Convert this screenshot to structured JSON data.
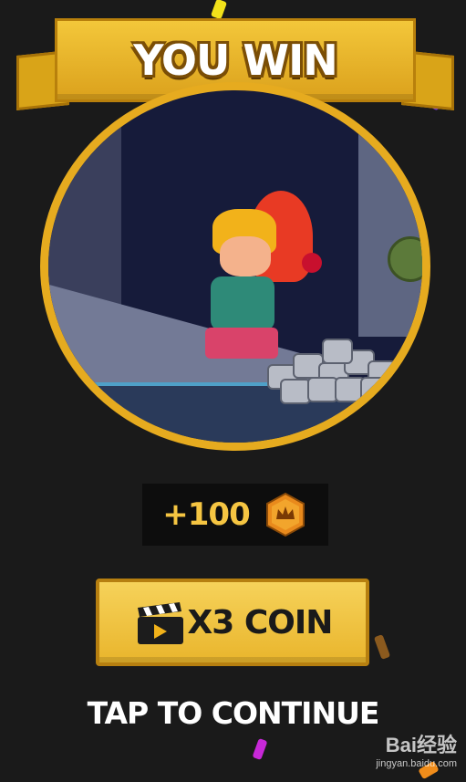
{
  "banner": {
    "title": "YOU WIN"
  },
  "reward": {
    "amount": "+100",
    "icon": "crown-coin-icon"
  },
  "video_bonus": {
    "label": "X3 COIN",
    "icon": "video-clapper-icon"
  },
  "tap_continue": {
    "label": "TAP TO CONTINUE"
  },
  "watermark": {
    "logo": "Bai经验",
    "url": "jingyan.baidu.com"
  },
  "colors": {
    "background": "#1a1a1a",
    "gold": "#e6ab1f",
    "reward_text": "#f5c542",
    "button": "#f6d25a"
  }
}
